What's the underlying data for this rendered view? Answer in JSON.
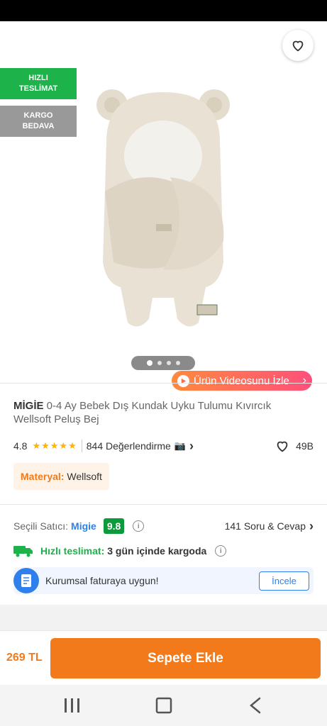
{
  "header": {
    "back_icon": "arrow-left-icon",
    "share_icon": "share-icon",
    "favorite_icon": "heart-outline-icon"
  },
  "badges": {
    "fast_delivery": [
      "HIZLI",
      "TESLİMAT"
    ],
    "free_shipping": [
      "KARGO",
      "BEDAVA"
    ]
  },
  "carousel": {
    "total": 4,
    "active": 1
  },
  "video_button": {
    "label": "Ürün Videosunu İzle",
    "chevron": "›"
  },
  "product": {
    "brand": "MİGİE",
    "name": " 0-4 Ay Bebek Dış Kundak Uyku Tulumu Kıvırcık Wellsoft Peluş Bej",
    "rating": "4.8",
    "stars": "★★★★★",
    "review_count": "844 Değerlendirme",
    "camera_icon": "📷",
    "chevron": "›",
    "favorites": "49B",
    "material_key": "Materyal:",
    "material_value": " Wellsoft"
  },
  "seller": {
    "label": "Seçili Satıcı:",
    "name": "Migie",
    "score": "9.8",
    "info": "i",
    "qa": "141 Soru & Cevap",
    "chevron": "›"
  },
  "shipping": {
    "label": "Hızlı teslimat:",
    "value": "3 gün içinde kargoda",
    "info": "i"
  },
  "corporate": {
    "text": "Kurumsal faturaya uygun!",
    "button": "İncele"
  },
  "buy": {
    "price": "269 TL",
    "button": "Sepete Ekle"
  },
  "colors": {
    "accent": "#f27a1a",
    "green": "#1db24a",
    "blue": "#2f80ed"
  }
}
